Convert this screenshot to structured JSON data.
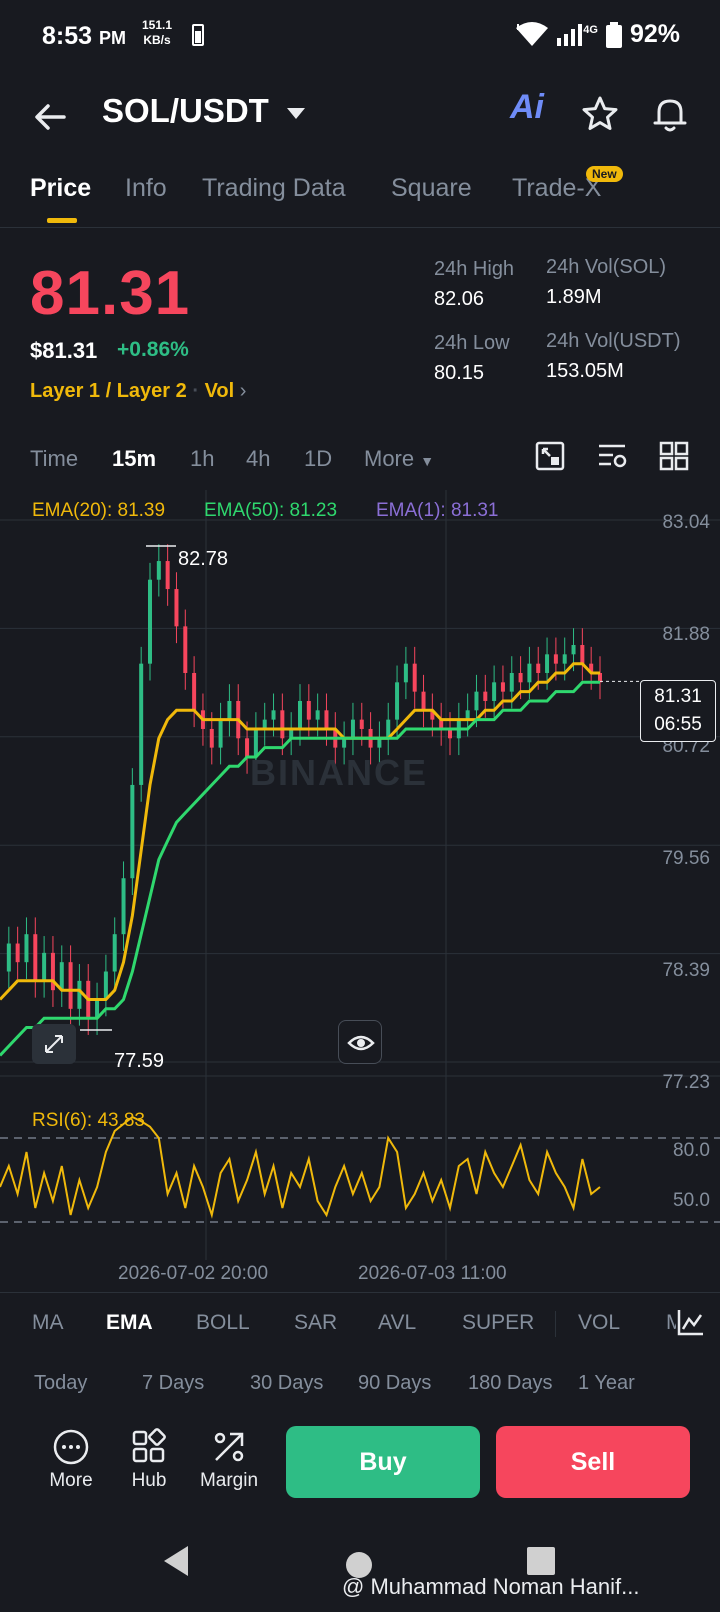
{
  "status": {
    "time": "8:53",
    "ampm": "PM",
    "speed": "151.1",
    "speed_unit": "KB/s",
    "network": "4G",
    "battery": "92%"
  },
  "header": {
    "pair": "SOL/USDT",
    "ai_label": "Ai"
  },
  "tabs": [
    {
      "label": "Price",
      "active": true
    },
    {
      "label": "Info"
    },
    {
      "label": "Trading Data"
    },
    {
      "label": "Square"
    },
    {
      "label": "Trade-X",
      "badge": "New"
    }
  ],
  "price": {
    "last": "81.31",
    "usd": "$81.31",
    "change": "+0.86%",
    "tag1": "Layer 1 / Layer 2",
    "tag2": "Vol",
    "high_label": "24h High",
    "high": "82.06",
    "low_label": "24h Low",
    "low": "80.15",
    "vol_sol_label": "24h Vol(SOL)",
    "vol_sol": "1.89M",
    "vol_usdt_label": "24h Vol(USDT)",
    "vol_usdt": "153.05M"
  },
  "intervals": [
    "Time",
    "15m",
    "1h",
    "4h",
    "1D",
    "More"
  ],
  "interval_active": "15m",
  "chart_data": {
    "type": "line",
    "ema20_label": "EMA(20): 81.39",
    "ema50_label": "EMA(50): 81.23",
    "ema1_label": "EMA(1): 81.31",
    "ylim": [
      77.23,
      83.04
    ],
    "price_ticks": [
      "83.04",
      "81.88",
      "80.72",
      "79.56",
      "78.39",
      "77.23"
    ],
    "current_price": "81.31",
    "countdown": "06:55",
    "high_mark": "82.78",
    "low_mark": "77.59",
    "watermark": "BINANCE",
    "price_series": [
      78.2,
      78.5,
      78.3,
      78.6,
      78.1,
      78.4,
      78.0,
      78.3,
      77.8,
      78.1,
      77.7,
      77.9,
      78.2,
      78.6,
      79.2,
      80.2,
      81.5,
      82.4,
      82.6,
      82.3,
      81.9,
      81.4,
      81.0,
      80.8,
      80.6,
      80.9,
      81.1,
      80.7,
      80.5,
      80.8,
      80.9,
      81.0,
      80.7,
      80.8,
      81.1,
      80.9,
      81.0,
      80.8,
      80.6,
      80.7,
      80.9,
      80.8,
      80.6,
      80.7,
      80.9,
      81.3,
      81.5,
      81.2,
      81.0,
      80.9,
      80.8,
      80.7,
      80.9,
      81.0,
      81.2,
      81.1,
      81.3,
      81.2,
      81.4,
      81.3,
      81.5,
      81.4,
      81.6,
      81.5,
      81.6,
      81.7,
      81.5,
      81.4,
      81.3
    ],
    "ema20_series": [
      77.9,
      78.0,
      78.1,
      78.1,
      78.1,
      78.1,
      78.1,
      78.0,
      78.0,
      78.0,
      77.9,
      77.9,
      77.9,
      78.0,
      78.3,
      78.8,
      79.5,
      80.2,
      80.7,
      80.9,
      81.0,
      81.0,
      81.0,
      80.9,
      80.9,
      80.9,
      80.9,
      80.9,
      80.8,
      80.8,
      80.8,
      80.8,
      80.8,
      80.8,
      80.8,
      80.8,
      80.8,
      80.8,
      80.8,
      80.7,
      80.7,
      80.7,
      80.7,
      80.7,
      80.7,
      80.8,
      80.9,
      81.0,
      81.0,
      81.0,
      80.9,
      80.9,
      80.9,
      80.9,
      80.9,
      81.0,
      81.0,
      81.1,
      81.1,
      81.2,
      81.2,
      81.3,
      81.3,
      81.4,
      81.4,
      81.5,
      81.5,
      81.4,
      81.4
    ],
    "ema50_series": [
      77.3,
      77.4,
      77.5,
      77.6,
      77.6,
      77.7,
      77.7,
      77.7,
      77.7,
      77.7,
      77.7,
      77.7,
      77.8,
      77.8,
      77.9,
      78.2,
      78.6,
      79.0,
      79.4,
      79.6,
      79.8,
      79.9,
      80.0,
      80.1,
      80.2,
      80.3,
      80.4,
      80.4,
      80.5,
      80.5,
      80.6,
      80.6,
      80.6,
      80.7,
      80.7,
      80.7,
      80.7,
      80.7,
      80.7,
      80.7,
      80.7,
      80.7,
      80.7,
      80.7,
      80.7,
      80.7,
      80.8,
      80.8,
      80.8,
      80.8,
      80.8,
      80.8,
      80.8,
      80.8,
      80.9,
      80.9,
      80.9,
      81.0,
      81.0,
      81.0,
      81.1,
      81.1,
      81.1,
      81.2,
      81.2,
      81.2,
      81.3,
      81.3,
      81.3
    ],
    "rsi_label": "RSI(6): 43.83",
    "rsi_ticks": [
      "80.0",
      "50.0"
    ],
    "rsi_series": [
      45,
      60,
      40,
      70,
      30,
      55,
      35,
      60,
      25,
      50,
      30,
      45,
      70,
      85,
      90,
      95,
      92,
      88,
      80,
      40,
      55,
      30,
      60,
      45,
      25,
      55,
      65,
      35,
      50,
      70,
      40,
      60,
      30,
      55,
      45,
      65,
      35,
      25,
      45,
      60,
      40,
      55,
      35,
      45,
      80,
      70,
      30,
      40,
      55,
      35,
      50,
      30,
      60,
      65,
      40,
      70,
      55,
      45,
      60,
      75,
      50,
      40,
      70,
      55,
      45,
      30,
      65,
      40,
      45
    ],
    "dates": [
      "2026-07-02 20:00",
      "2026-07-03 11:00"
    ]
  },
  "indicators": [
    "MA",
    "EMA",
    "BOLL",
    "SAR",
    "AVL",
    "SUPER",
    "VOL",
    "M"
  ],
  "indicator_active": "EMA",
  "performance": [
    {
      "label": "Today",
      "color": "#2ebd85"
    },
    {
      "label": "7 Days",
      "color": "#2ebd85"
    },
    {
      "label": "30 Days",
      "color": "#2ebd85"
    },
    {
      "label": "90 Days",
      "color": "#2ebd85"
    },
    {
      "label": "180 Days",
      "color": "#f6465d"
    },
    {
      "label": "1 Year",
      "color": "#f6465d"
    }
  ],
  "actions": {
    "more": "More",
    "hub": "Hub",
    "margin": "Margin",
    "buy": "Buy",
    "sell": "Sell"
  },
  "credit": "@ Muhammad Noman Hanif...",
  "colors": {
    "bg": "#181a20",
    "up": "#2ebd85",
    "down": "#f6465d",
    "accent": "#f0b90b",
    "ema50": "#2fd86e",
    "ema1": "#8b6fd6"
  }
}
